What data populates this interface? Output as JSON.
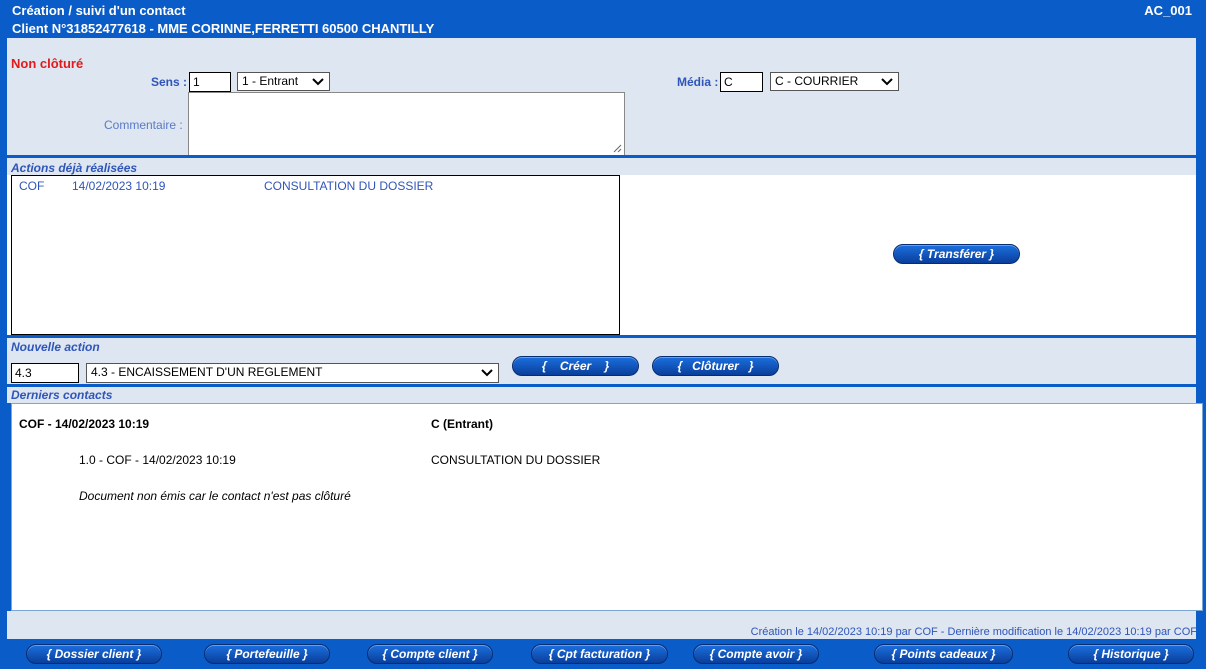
{
  "header": {
    "title": "Création / suivi d'un contact",
    "client_line": "Client N°31852477618 - MME CORINNE,FERRETTI 60500 CHANTILLY",
    "screen_code": "AC_001"
  },
  "form": {
    "status": "Non clôturé",
    "sens_label": "Sens :",
    "sens_code": "1",
    "sens_select": "1 - Entrant",
    "media_label": "Média :",
    "media_code": "C",
    "media_select": "C - COURRIER",
    "comment_label": "Commentaire :",
    "comment_value": ""
  },
  "actions_done": {
    "title": "Actions déjà réalisées",
    "rows": [
      {
        "user": "COF",
        "date": "14/02/2023 10:19",
        "label": "CONSULTATION DU DOSSIER"
      }
    ],
    "transfer_button": "{ Transférer }"
  },
  "new_action": {
    "title": "Nouvelle action",
    "code": "4.3",
    "select": "4.3 - ENCAISSEMENT D'UN REGLEMENT",
    "create_button": "{    Créer    }",
    "close_button": "{   Clôturer   }"
  },
  "last_contacts": {
    "title": "Derniers contacts",
    "head_left": "COF - 14/02/2023 10:19",
    "head_right": "C (Entrant)",
    "line_left": "1.0 - COF - 14/02/2023 10:19",
    "line_right": "CONSULTATION DU DOSSIER",
    "note": "Document non émis car le contact n'est pas clôturé"
  },
  "footer": {
    "audit": "Création le 14/02/2023 10:19 par COF - Dernière modification le 14/02/2023 10:19 par COF",
    "buttons": [
      "{ Dossier client }",
      "{ Portefeuille }",
      "{ Compte client }",
      "{ Cpt facturation }",
      "{ Compte avoir }",
      "{ Points cadeaux }",
      "{ Historique }"
    ]
  },
  "colors": {
    "brand_blue": "#0a5cc8",
    "panel_bg": "#dde6f1",
    "status_red": "#e01b1b",
    "label_blue": "#2f55b8"
  }
}
